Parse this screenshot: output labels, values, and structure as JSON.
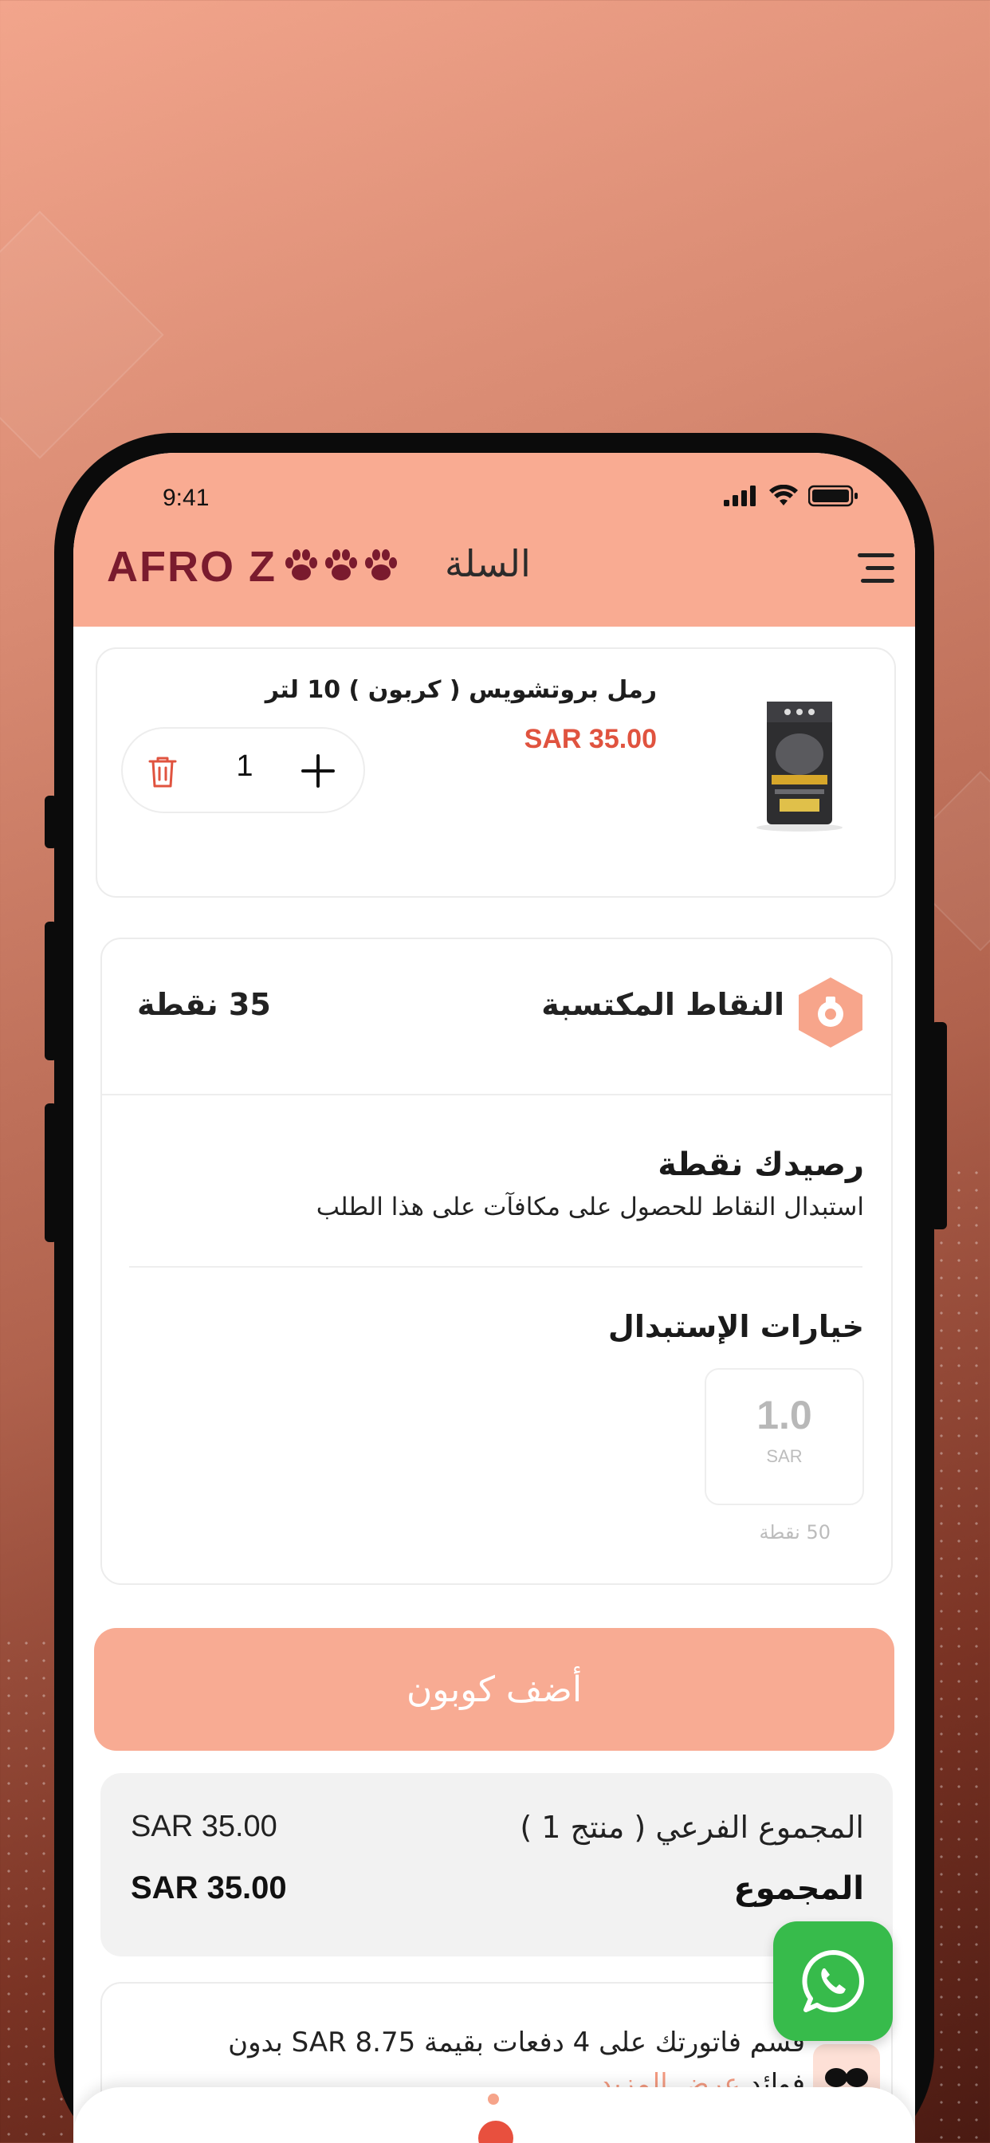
{
  "status_bar": {
    "time": "9:41"
  },
  "header": {
    "brand": "AFRO Z",
    "title": "السلة"
  },
  "cart": {
    "items": [
      {
        "name": "رمل بروتشويس ( كربون ) 10 لتر",
        "price": "SAR 35.00",
        "quantity": "1"
      }
    ]
  },
  "points": {
    "label": "النقاط المكتسبة",
    "earned": "35 نقطة",
    "balance_title": "رصيدك  نقطة",
    "balance_desc": "استبدال النقاط للحصول على مكافآت على هذا الطلب",
    "options_title": "خيارات الإستبدال",
    "options": [
      {
        "value": "1.0",
        "currency": "SAR",
        "points": "50 نقطة"
      }
    ]
  },
  "coupon": {
    "button_label": "أضف كوبون"
  },
  "summary": {
    "subtotal_label": "المجموع الفرعي ( منتج 1 )",
    "subtotal_value": "SAR 35.00",
    "total_label": "المجموع",
    "total_value": "SAR 35.00"
  },
  "installment": {
    "text": "قسم فاتورتك على 4 دفعات بقيمة SAR 8.75 بدون",
    "text_cont": "فوائد",
    "link": "عرض المزيد"
  },
  "colors": {
    "accent": "#f9ab92",
    "price": "#e0533f",
    "brand": "#7a1b2e",
    "whatsapp": "#37bb4b"
  },
  "icons": [
    "signal-icon",
    "wifi-icon",
    "battery-icon",
    "menu-icon",
    "trash-icon",
    "plus-icon",
    "points-hex-icon",
    "whatsapp-icon",
    "installment-logo-icon"
  ]
}
